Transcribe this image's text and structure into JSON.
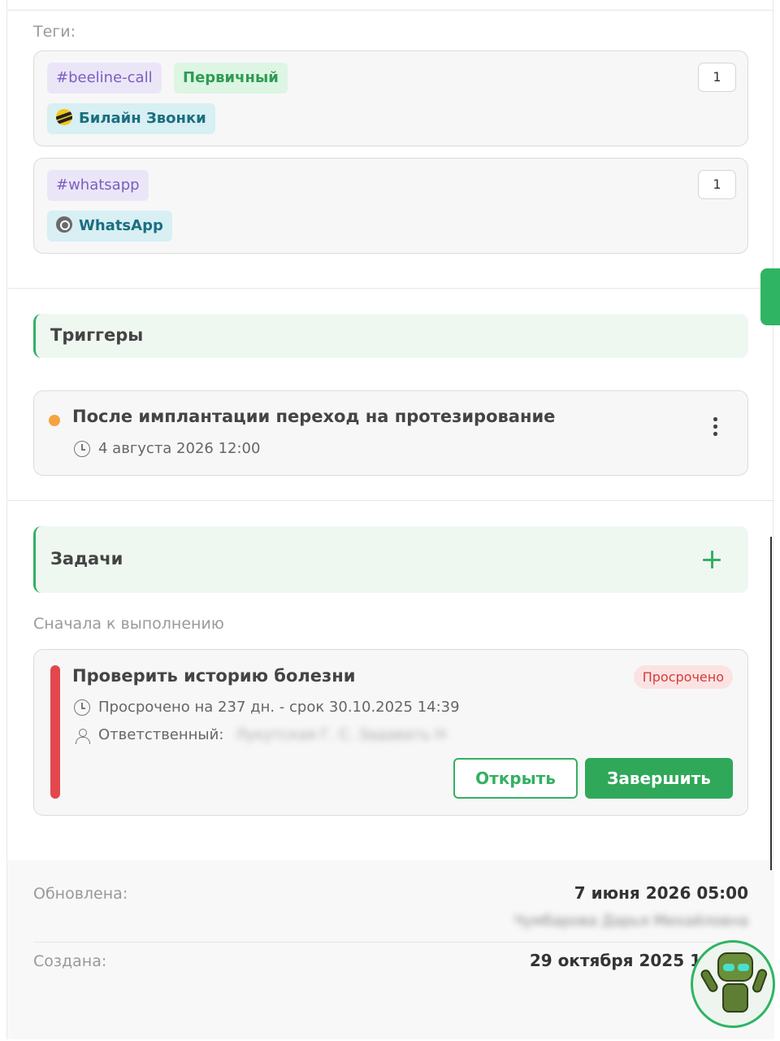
{
  "tags": {
    "label": "Теги:",
    "groups": [
      {
        "chips": [
          "#beeline-call",
          "Первичный"
        ],
        "source": "Билайн Звонки",
        "count": "1"
      },
      {
        "chips": [
          "#whatsapp"
        ],
        "source": "WhatsApp",
        "count": "1"
      }
    ]
  },
  "triggers": {
    "title": "Триггеры",
    "items": [
      {
        "title": "После имплантации переход на протезирование",
        "datetime": "4 августа 2026 12:00"
      }
    ]
  },
  "tasks": {
    "title": "Задачи",
    "sort_label": "Сначала к выполнению",
    "items": [
      {
        "title": "Проверить историю болезни",
        "status": "Просрочено",
        "due": "Просрочено на 237 дн. - срок 30.10.2025 14:39",
        "responsible_label": "Ответственный:",
        "responsible_value": "Лукутская Г. С. Задавать Н",
        "open_label": "Открыть",
        "complete_label": "Завершить"
      }
    ]
  },
  "footer": {
    "updated_label": "Обновлена:",
    "updated_value": "7 июня 2026 05:00",
    "updated_by": "Чумбарова Дарья Михайловна",
    "created_label": "Создана:",
    "created_value": "29 октября 2025 1"
  },
  "colors": {
    "accent": "#2fa85a",
    "danger": "#e2474d",
    "trigger_dot": "#f4a340"
  }
}
